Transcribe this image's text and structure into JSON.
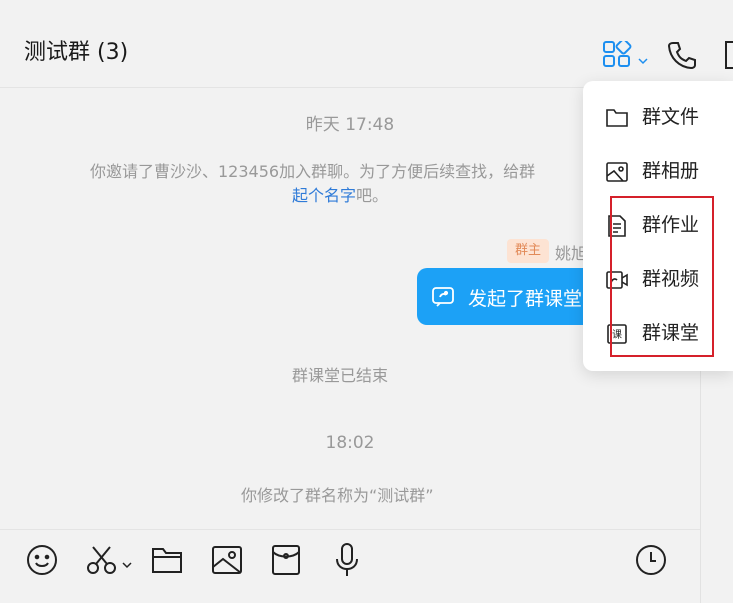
{
  "header": {
    "title": "测试群 (3)",
    "icons": [
      "apps-icon",
      "chevron-down-icon",
      "phone-icon",
      "edit-icon"
    ]
  },
  "messages": {
    "timestamp1": "昨天 17:48",
    "system_notice_1_line1": "你邀请了曹沙沙、123456加入群聊。为了方便后续查找，给群",
    "system_notice_1_link": "起个名字",
    "system_notice_1_tail": "吧。",
    "owner_badge": "群主",
    "sender_name": "姚旭",
    "bubble_text": "发起了群课堂",
    "class_ended": "群课堂已结束",
    "timestamp2": "18:02",
    "rename_notice": "你修改了群名称为“测试群”"
  },
  "menu": {
    "items": [
      {
        "label": "群文件",
        "icon": "folder-icon"
      },
      {
        "label": "群相册",
        "icon": "album-icon"
      },
      {
        "label": "群作业",
        "icon": "homework-icon"
      },
      {
        "label": "群视频",
        "icon": "video-icon"
      },
      {
        "label": "群课堂",
        "icon": "classroom-icon"
      }
    ],
    "highlight_color": "#d5202a"
  },
  "toolbar": {
    "icons": [
      "emoji-icon",
      "scissors-icon",
      "folder-icon",
      "image-icon",
      "red-packet-icon",
      "microphone-icon",
      "clock-icon"
    ]
  },
  "colors": {
    "accent": "#1ca1f6",
    "link": "#2f7bd8",
    "background": "#f2f2f2"
  }
}
